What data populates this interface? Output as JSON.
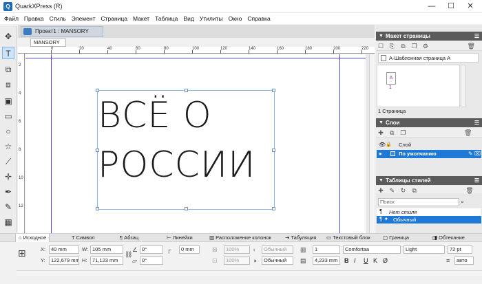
{
  "window": {
    "title": "QuarkXPress (R)",
    "minimize": "—",
    "maximize": "☐",
    "close": "✕"
  },
  "menu": [
    "Файл",
    "Правка",
    "Стиль",
    "Элемент",
    "Страница",
    "Макет",
    "Таблица",
    "Вид",
    "Утилиты",
    "Окно",
    "Справка"
  ],
  "document": {
    "tab_title": "Проект1 : MANSORY",
    "layout_tab": "MANSORY"
  },
  "ruler": {
    "h_labels": [
      "0",
      "20",
      "40",
      "60",
      "80",
      "100",
      "120",
      "140",
      "160",
      "180",
      "200",
      "220"
    ],
    "v_labels": [
      "2",
      "4",
      "6",
      "8",
      "10",
      "12"
    ]
  },
  "canvas": {
    "headline_lines": [
      "ВСЁ О",
      "РОССИИ"
    ]
  },
  "page_layout_panel": {
    "title": "Макет страницы",
    "master_item": "А-Шаблонная страница А",
    "page_letter": "A",
    "page_number": "1",
    "footer": "1 Страница"
  },
  "layers_panel": {
    "title": "Слои",
    "column_label": "Слой",
    "default_layer": "По умолчанию"
  },
  "style_sheets_panel": {
    "title": "Таблицы стилей",
    "search_placeholder": "Поиск",
    "items": [
      "Нет стиля",
      "Обычный"
    ]
  },
  "measurements_tabs": [
    "Исходное",
    "Символ",
    "Абзац",
    "Линейки",
    "Расположение колонок",
    "Табуляция",
    "Текстовый блок",
    "Граница",
    "Обтекание"
  ],
  "measurements": {
    "x_label": "X:",
    "x_value": "40 mm",
    "y_label": "Y:",
    "y_value": "122,679 mm",
    "w_label": "W:",
    "w_value": "105 mm",
    "h_label": "H:",
    "h_value": "71,123 mm",
    "angle_value": "0°",
    "skew_value": "0°",
    "corner_value": "0 mm",
    "opacity_1": "100%",
    "opacity_2": "100%",
    "blend_1": "Обычный",
    "blend_2": "Обычный",
    "columns_value": "1",
    "gutter_value": "4,233 mm",
    "font_name": "Comfortaa",
    "font_style": "Light",
    "font_size": "72 pt",
    "leading": "авто",
    "text_style_buttons": [
      "B",
      "I",
      "U",
      "K",
      "Ø"
    ]
  },
  "colors": {
    "accent": "#1e78d6",
    "panel_header": "#5a5a5a",
    "guide": "#4a4adf"
  }
}
